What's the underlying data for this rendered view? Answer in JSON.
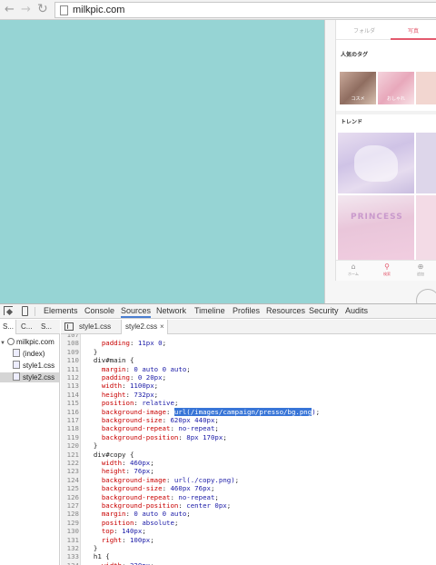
{
  "browser": {
    "back_glyph": "←",
    "forward_glyph": "→",
    "reload_glyph": "↻",
    "url": "milkpic.com"
  },
  "phone_app": {
    "tabs": [
      "フォルダ",
      "写真"
    ],
    "active_tab": "写真",
    "popular_tags_heading": "人気のタグ",
    "tag_labels": [
      "コスメ",
      "おしゃれ"
    ],
    "trend_heading": "トレンド",
    "trend_image_text": "PRINCESS",
    "nav": [
      {
        "glyph": "⌂",
        "label": "ホーム"
      },
      {
        "glyph": "⚲",
        "label": "検索"
      },
      {
        "glyph": "⊕",
        "label": "追加"
      }
    ],
    "accent_color": "#e35a6e",
    "page_background": "#96d4d4"
  },
  "devtools": {
    "tabs": [
      "Elements",
      "Console",
      "Sources",
      "Network",
      "Timeline",
      "Profiles",
      "Resources",
      "Security",
      "Audits"
    ],
    "active_tab": "Sources",
    "navigator_tabs": [
      "S...",
      "C...",
      "S..."
    ],
    "tree": {
      "origin": "milkpic.com",
      "files": [
        "(index)",
        "style1.css",
        "style2.css"
      ],
      "selected": "style2.css"
    },
    "editor_tabs": [
      "style1.css",
      "style2.css"
    ],
    "active_editor_tab": "style2.css",
    "close_glyph": "×",
    "code_lines": [
      {
        "n": "107",
        "parts": [
          {
            "t": "",
            "c": "sel"
          }
        ]
      },
      {
        "n": "108",
        "parts": [
          {
            "t": "    ",
            "c": "sel"
          },
          {
            "t": "padding",
            "c": "prop"
          },
          {
            "t": ": ",
            "c": "sel"
          },
          {
            "t": "11px 0",
            "c": "val"
          },
          {
            "t": ";",
            "c": "sel"
          }
        ]
      },
      {
        "n": "109",
        "parts": [
          {
            "t": "  }",
            "c": "sel"
          }
        ]
      },
      {
        "n": "110",
        "parts": [
          {
            "t": "  div#main {",
            "c": "sel"
          }
        ]
      },
      {
        "n": "111",
        "parts": [
          {
            "t": "    ",
            "c": "sel"
          },
          {
            "t": "margin",
            "c": "prop"
          },
          {
            "t": ": ",
            "c": "sel"
          },
          {
            "t": "0 auto 0 auto",
            "c": "val"
          },
          {
            "t": ";",
            "c": "sel"
          }
        ]
      },
      {
        "n": "112",
        "parts": [
          {
            "t": "    ",
            "c": "sel"
          },
          {
            "t": "padding",
            "c": "prop"
          },
          {
            "t": ": ",
            "c": "sel"
          },
          {
            "t": "0 20px",
            "c": "val"
          },
          {
            "t": ";",
            "c": "sel"
          }
        ]
      },
      {
        "n": "113",
        "parts": [
          {
            "t": "    ",
            "c": "sel"
          },
          {
            "t": "width",
            "c": "prop"
          },
          {
            "t": ": ",
            "c": "sel"
          },
          {
            "t": "1100px",
            "c": "val"
          },
          {
            "t": ";",
            "c": "sel"
          }
        ]
      },
      {
        "n": "114",
        "parts": [
          {
            "t": "    ",
            "c": "sel"
          },
          {
            "t": "height",
            "c": "prop"
          },
          {
            "t": ": ",
            "c": "sel"
          },
          {
            "t": "732px",
            "c": "val"
          },
          {
            "t": ";",
            "c": "sel"
          }
        ]
      },
      {
        "n": "115",
        "parts": [
          {
            "t": "    ",
            "c": "sel"
          },
          {
            "t": "position",
            "c": "prop"
          },
          {
            "t": ": ",
            "c": "sel"
          },
          {
            "t": "relative",
            "c": "val"
          },
          {
            "t": ";",
            "c": "sel"
          }
        ]
      },
      {
        "n": "116",
        "parts": [
          {
            "t": "    ",
            "c": "sel"
          },
          {
            "t": "background-image",
            "c": "prop"
          },
          {
            "t": ": ",
            "c": "sel"
          },
          {
            "t": "url(/images/campaign/presso/bg.png",
            "c": "sel-hl"
          },
          {
            "t": ")",
            "c": "val"
          },
          {
            "t": ";",
            "c": "sel"
          }
        ]
      },
      {
        "n": "117",
        "parts": [
          {
            "t": "    ",
            "c": "sel"
          },
          {
            "t": "background-size",
            "c": "prop"
          },
          {
            "t": ": ",
            "c": "sel"
          },
          {
            "t": "620px 440px",
            "c": "val"
          },
          {
            "t": ";",
            "c": "sel"
          }
        ]
      },
      {
        "n": "118",
        "parts": [
          {
            "t": "    ",
            "c": "sel"
          },
          {
            "t": "background-repeat",
            "c": "prop"
          },
          {
            "t": ": ",
            "c": "sel"
          },
          {
            "t": "no-repeat",
            "c": "val"
          },
          {
            "t": ";",
            "c": "sel"
          }
        ]
      },
      {
        "n": "119",
        "parts": [
          {
            "t": "    ",
            "c": "sel"
          },
          {
            "t": "background-position",
            "c": "prop"
          },
          {
            "t": ": ",
            "c": "sel"
          },
          {
            "t": "8px 170px",
            "c": "val"
          },
          {
            "t": ";",
            "c": "sel"
          }
        ]
      },
      {
        "n": "120",
        "parts": [
          {
            "t": "  }",
            "c": "sel"
          }
        ]
      },
      {
        "n": "121",
        "parts": [
          {
            "t": "  div#copy {",
            "c": "sel"
          }
        ]
      },
      {
        "n": "122",
        "parts": [
          {
            "t": "    ",
            "c": "sel"
          },
          {
            "t": "width",
            "c": "prop"
          },
          {
            "t": ": ",
            "c": "sel"
          },
          {
            "t": "460px",
            "c": "val"
          },
          {
            "t": ";",
            "c": "sel"
          }
        ]
      },
      {
        "n": "123",
        "parts": [
          {
            "t": "    ",
            "c": "sel"
          },
          {
            "t": "height",
            "c": "prop"
          },
          {
            "t": ": ",
            "c": "sel"
          },
          {
            "t": "76px",
            "c": "val"
          },
          {
            "t": ";",
            "c": "sel"
          }
        ]
      },
      {
        "n": "124",
        "parts": [
          {
            "t": "    ",
            "c": "sel"
          },
          {
            "t": "background-image",
            "c": "prop"
          },
          {
            "t": ": ",
            "c": "sel"
          },
          {
            "t": "url(./copy.png)",
            "c": "val"
          },
          {
            "t": ";",
            "c": "sel"
          }
        ]
      },
      {
        "n": "125",
        "parts": [
          {
            "t": "    ",
            "c": "sel"
          },
          {
            "t": "background-size",
            "c": "prop"
          },
          {
            "t": ": ",
            "c": "sel"
          },
          {
            "t": "460px 76px",
            "c": "val"
          },
          {
            "t": ";",
            "c": "sel"
          }
        ]
      },
      {
        "n": "126",
        "parts": [
          {
            "t": "    ",
            "c": "sel"
          },
          {
            "t": "background-repeat",
            "c": "prop"
          },
          {
            "t": ": ",
            "c": "sel"
          },
          {
            "t": "no-repeat",
            "c": "val"
          },
          {
            "t": ";",
            "c": "sel"
          }
        ]
      },
      {
        "n": "127",
        "parts": [
          {
            "t": "    ",
            "c": "sel"
          },
          {
            "t": "background-position",
            "c": "prop"
          },
          {
            "t": ": ",
            "c": "sel"
          },
          {
            "t": "center 0px",
            "c": "val"
          },
          {
            "t": ";",
            "c": "sel"
          }
        ]
      },
      {
        "n": "128",
        "parts": [
          {
            "t": "    ",
            "c": "sel"
          },
          {
            "t": "margin",
            "c": "prop"
          },
          {
            "t": ": ",
            "c": "sel"
          },
          {
            "t": "0 auto 0 auto",
            "c": "val"
          },
          {
            "t": ";",
            "c": "sel"
          }
        ]
      },
      {
        "n": "129",
        "parts": [
          {
            "t": "    ",
            "c": "sel"
          },
          {
            "t": "position",
            "c": "prop"
          },
          {
            "t": ": ",
            "c": "sel"
          },
          {
            "t": "absolute",
            "c": "val"
          },
          {
            "t": ";",
            "c": "sel"
          }
        ]
      },
      {
        "n": "130",
        "parts": [
          {
            "t": "    ",
            "c": "sel"
          },
          {
            "t": "top",
            "c": "prop"
          },
          {
            "t": ": ",
            "c": "sel"
          },
          {
            "t": "140px",
            "c": "val"
          },
          {
            "t": ";",
            "c": "sel"
          }
        ]
      },
      {
        "n": "131",
        "parts": [
          {
            "t": "    ",
            "c": "sel"
          },
          {
            "t": "right",
            "c": "prop"
          },
          {
            "t": ": ",
            "c": "sel"
          },
          {
            "t": "100px",
            "c": "val"
          },
          {
            "t": ";",
            "c": "sel"
          }
        ]
      },
      {
        "n": "132",
        "parts": [
          {
            "t": "  }",
            "c": "sel"
          }
        ]
      },
      {
        "n": "133",
        "parts": [
          {
            "t": "  h1 {",
            "c": "sel"
          }
        ]
      },
      {
        "n": "134",
        "parts": [
          {
            "t": "    ",
            "c": "sel"
          },
          {
            "t": "width",
            "c": "prop"
          },
          {
            "t": ": ",
            "c": "sel"
          },
          {
            "t": "320px",
            "c": "val"
          },
          {
            "t": ";",
            "c": "sel"
          }
        ]
      }
    ]
  }
}
